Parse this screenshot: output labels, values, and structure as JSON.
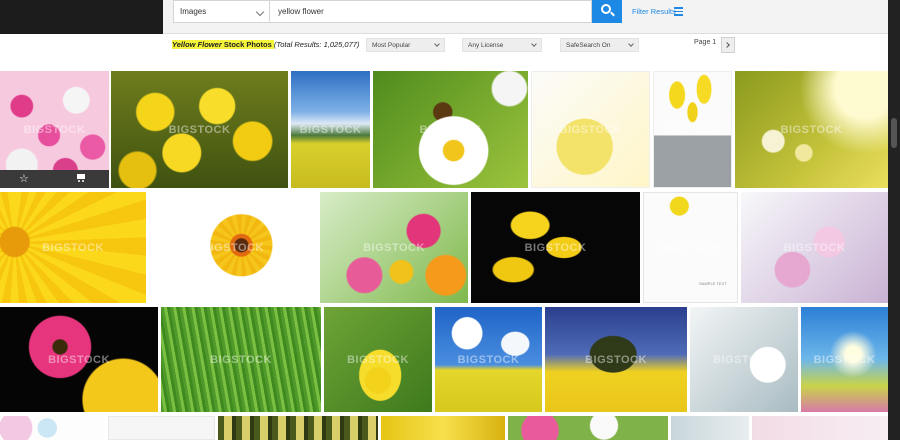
{
  "search": {
    "type_value": "Images",
    "query": "yellow flower",
    "filter_label": "Filter Results"
  },
  "results": {
    "title_subject": "Yellow Flower",
    "title_suffix": " Stock Photos ",
    "total_text": "(Total Results: 1,025,077)"
  },
  "toolbar": {
    "sort": "Most Popular",
    "license": "Any License",
    "safesearch": "SafeSearch On",
    "page": "Page 1"
  },
  "watermark": "BIGSTOCK",
  "sample_text": "SAMPLE TEXT",
  "icons": {
    "star": "star-icon",
    "cart": "cart-icon",
    "search": "search-icon",
    "filter": "filter-sliders-icon",
    "next": "chevron-right-icon"
  }
}
